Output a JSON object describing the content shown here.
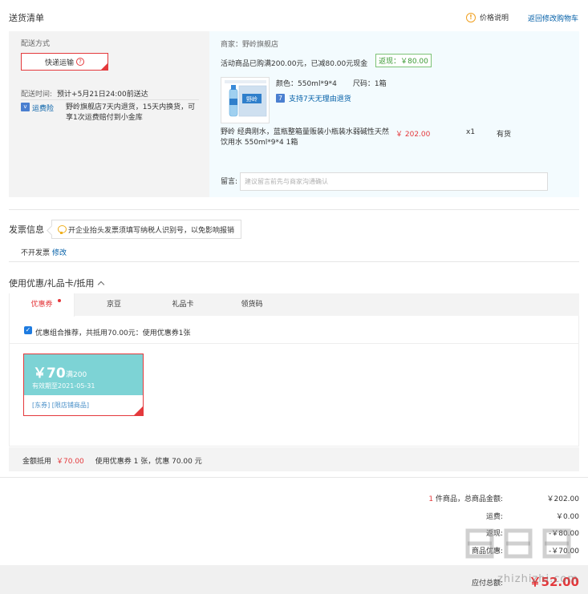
{
  "header": {
    "title": "送货清单",
    "price_info": "价格说明",
    "back_to_cart": "返回修改购物车"
  },
  "shipping": {
    "method_label": "配送方式",
    "method_value": "快递运输",
    "time_label": "配送时间:",
    "time_value": "预计+5月21日24:00前送达",
    "freight_icon": "shield-icon",
    "freight_label": "运费险",
    "freight_desc": "野岭旗舰店7天内退货，15天内换货，可享1次运费赔付到小金库"
  },
  "order": {
    "merchant": "商家：野岭旗舰店",
    "promo": "活动商品已购满200.00元，已减80.00元现金",
    "cashback": "返现：￥80.00",
    "color": "颜色：550ml*9*4",
    "size": "尺码：1箱",
    "return_policy": "支持7天无理由退货",
    "product_name": "野岭 经典刚水，蓝瓶整箱量贩装小瓶装水弱碱性天然饮用水 550ml*9*4 1箱",
    "price": "￥ 202.00",
    "qty": "x1",
    "stock": "有货",
    "message_label": "留言:",
    "message_placeholder": "建议留言前先与商家沟通确认"
  },
  "invoice": {
    "title": "发票信息",
    "tip": "开企业抬头发票须填写纳税人识别号，以免影响报销",
    "status": "不开发票",
    "modify": "修改"
  },
  "coupons": {
    "title": "使用优惠/礼品卡/抵用",
    "tabs": [
      "优惠券",
      "京豆",
      "礼品卡",
      "领货码"
    ],
    "recommend_text": "优惠组合推荐，共抵用70.00元：使用优惠券1张",
    "coupon_amount": "￥70",
    "coupon_condition": "满200",
    "coupon_valid": "有效期至2021-05-31",
    "coupon_tag": "[东券] [限店铺商品]",
    "summary_label": "金额抵用",
    "summary_amount": "￥70.00",
    "summary_text": "使用优惠券 1 张，优惠 70.00 元"
  },
  "totals": {
    "items_count": "1",
    "items_label": "件商品，总商品金额:",
    "items_value": "￥202.00",
    "shipping_label": "运费:",
    "shipping_value": "￥0.00",
    "cashback_label": "返现:",
    "cashback_value": "-￥80.00",
    "coupon_label": "商品优惠:",
    "coupon_value": "-￥70.00",
    "pay_label": "应付总额:",
    "pay_value": "￥52.00"
  },
  "watermark": {
    "text": "zhizhizhi.com"
  },
  "colors": {
    "accent_red": "#e4393c",
    "link_blue": "#005ea7",
    "coupon_teal": "#7dd3d5",
    "cashback_green": "#3c9a35"
  }
}
